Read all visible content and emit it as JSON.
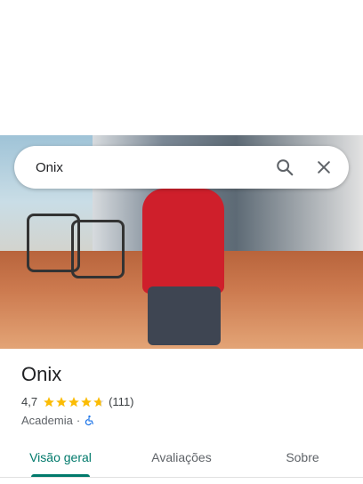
{
  "search": {
    "query": "Onix",
    "search_icon": "search-icon",
    "clear_icon": "close-icon"
  },
  "hero_photo": {
    "description_icon": "place-photo"
  },
  "place": {
    "name": "Onix",
    "rating": "4,7",
    "rating_value": 4.7,
    "review_count": "(111)",
    "category": "Academia",
    "separator": "·",
    "accessibility_icon": "wheelchair-icon",
    "star_color": "#fbbc04",
    "accessibility_color": "#1a73e8"
  },
  "tabs": [
    {
      "label": "Visão geral",
      "active": true
    },
    {
      "label": "Avaliações",
      "active": false
    },
    {
      "label": "Sobre",
      "active": false
    }
  ],
  "accent_color": "#00796b"
}
